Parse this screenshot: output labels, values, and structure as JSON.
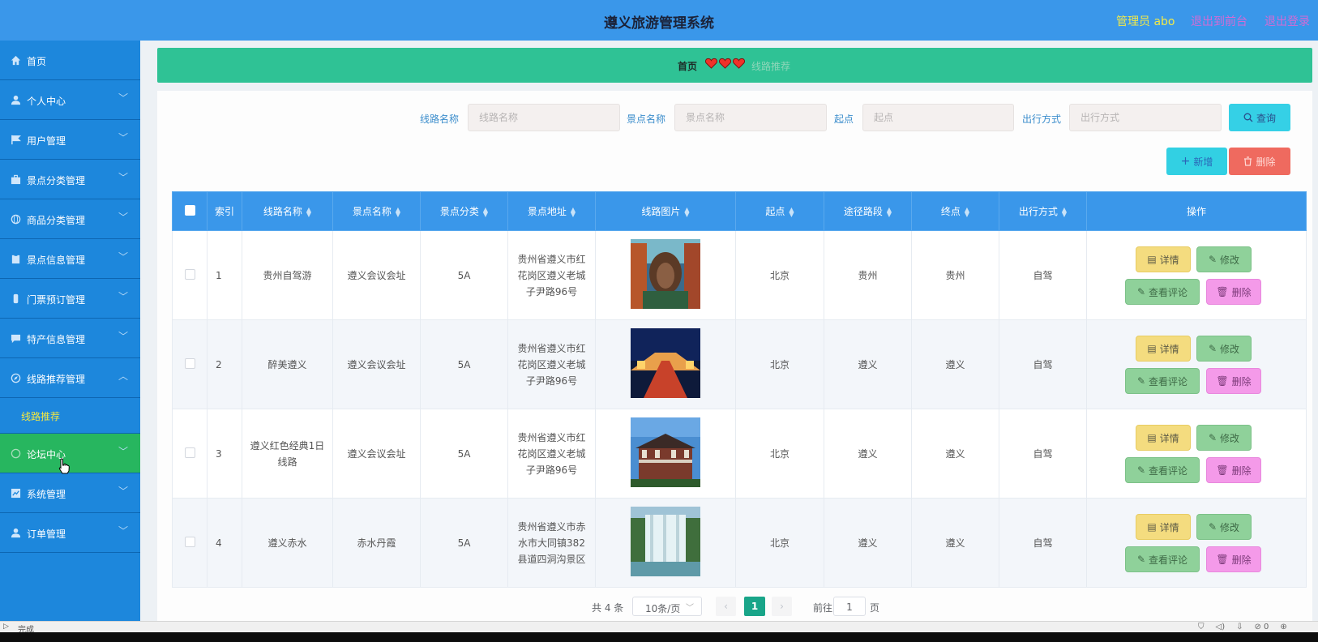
{
  "header": {
    "title": "遵义旅游管理系统",
    "admin": "管理员 abo",
    "back_front": "退出到前台",
    "logout": "退出登录"
  },
  "sidebar": {
    "items": [
      {
        "label": "首页",
        "icon": "home-icon",
        "chevron": ""
      },
      {
        "label": "个人中心",
        "icon": "user-icon",
        "chevron": "﹀"
      },
      {
        "label": "用户管理",
        "icon": "flag-icon",
        "chevron": "﹀"
      },
      {
        "label": "景点分类管理",
        "icon": "briefcase-icon",
        "chevron": "﹀"
      },
      {
        "label": "商品分类管理",
        "icon": "globe-icon",
        "chevron": "﹀"
      },
      {
        "label": "景点信息管理",
        "icon": "clipboard-icon",
        "chevron": "﹀"
      },
      {
        "label": "门票预订管理",
        "icon": "mic-icon",
        "chevron": "﹀"
      },
      {
        "label": "特产信息管理",
        "icon": "chat-icon",
        "chevron": "﹀"
      },
      {
        "label": "线路推荐管理",
        "icon": "compass-icon",
        "chevron": "︿"
      },
      {
        "label": "论坛中心",
        "icon": "circle-icon",
        "chevron": "﹀"
      },
      {
        "label": "系统管理",
        "icon": "chart-icon",
        "chevron": "﹀"
      },
      {
        "label": "订单管理",
        "icon": "user-icon",
        "chevron": "﹀"
      }
    ],
    "submenu_label": "线路推荐"
  },
  "breadcrumb": {
    "home": "首页",
    "current": "线路推荐"
  },
  "search": {
    "route_name_label": "线路名称",
    "route_name_placeholder": "线路名称",
    "spot_name_label": "景点名称",
    "spot_name_placeholder": "景点名称",
    "start_label": "起点",
    "start_placeholder": "起点",
    "travel_mode_label": "出行方式",
    "travel_mode_placeholder": "出行方式",
    "query_button": "查询"
  },
  "actions": {
    "add": "新增",
    "delete": "删除"
  },
  "table": {
    "headers": [
      "索引",
      "线路名称",
      "景点名称",
      "景点分类",
      "景点地址",
      "线路图片",
      "起点",
      "途径路段",
      "终点",
      "出行方式",
      "操作"
    ],
    "rows": [
      {
        "index": "1",
        "route": "贵州自驾游",
        "spot": "遵义会议会址",
        "category": "5A",
        "address": "贵州省遵义市红花岗区遵义老城子尹路96号",
        "start": "北京",
        "via": "贵州",
        "end": "贵州",
        "mode": "自驾"
      },
      {
        "index": "2",
        "route": "醉美遵义",
        "spot": "遵义会议会址",
        "category": "5A",
        "address": "贵州省遵义市红花岗区遵义老城子尹路96号",
        "start": "北京",
        "via": "遵义",
        "end": "遵义",
        "mode": "自驾"
      },
      {
        "index": "3",
        "route": "遵义红色经典1日线路",
        "spot": "遵义会议会址",
        "category": "5A",
        "address": "贵州省遵义市红花岗区遵义老城子尹路96号",
        "start": "北京",
        "via": "遵义",
        "end": "遵义",
        "mode": "自驾"
      },
      {
        "index": "4",
        "route": "遵义赤水",
        "spot": "赤水丹霞",
        "category": "5A",
        "address": "贵州省遵义市赤水市大同镇382县道四洞沟景区",
        "start": "北京",
        "via": "遵义",
        "end": "遵义",
        "mode": "自驾"
      }
    ],
    "op_detail": "详情",
    "op_edit": "修改",
    "op_review": "查看评论",
    "op_delete": "删除"
  },
  "pagination": {
    "total": "共 4 条",
    "page_size": "10条/页",
    "current_page": "1",
    "goto_label": "前往",
    "goto_value": "1",
    "page_suffix": "页"
  },
  "statusbar": {
    "text": "完成",
    "count": "0"
  },
  "colors": {
    "header": "#3a97ea",
    "sidebar": "#1d87dc",
    "sidebar_active": "#27b65f",
    "breadcrumb": "#2fc295",
    "table_header": "#3a97ea",
    "page_active": "#19a589"
  }
}
